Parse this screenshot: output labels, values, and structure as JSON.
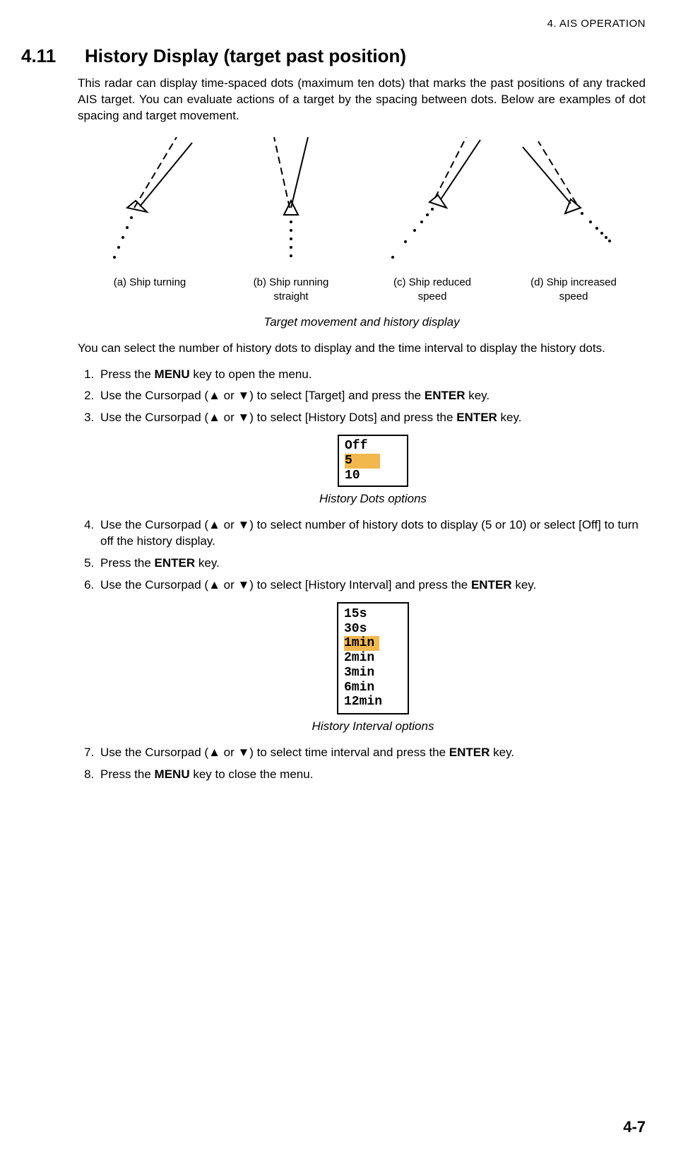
{
  "header": {
    "running": "4.  AIS OPERATION"
  },
  "section": {
    "number": "4.11",
    "title": "History Display (target past position)"
  },
  "intro": "This radar can display time-spaced dots (maximum ten dots) that marks the past positions of any tracked AIS target. You can evaluate actions of a target by the spacing between dots. Below are examples of dot spacing and target movement.",
  "fig_labels": {
    "a": "(a) Ship turning",
    "b_line1": "(b) Ship running",
    "b_line2": "straight",
    "c_line1": "(c) Ship reduced",
    "c_line2": "speed",
    "d_line1": "(d) Ship increased",
    "d_line2": "speed"
  },
  "fig_title": "Target movement and history display",
  "intro2": "You can select the number of history dots to display and the time interval to display the history dots.",
  "steps": {
    "s1_a": "Press the ",
    "s1_menu": "MENU",
    "s1_b": " key to open the menu.",
    "s2_a": "Use the Cursorpad (▲ or ▼) to select [Target] and press the ",
    "s2_enter": "ENTER",
    "s2_b": " key.",
    "s3_a": "Use the Cursorpad (▲ or ▼) to select [History Dots] and press the ",
    "s3_enter": "ENTER",
    "s3_b": " key.",
    "s4": "Use the Cursorpad (▲ or ▼) to select number of history dots to display (5 or 10) or select [Off] to turn off the history display.",
    "s5_a": "Press the ",
    "s5_enter": "ENTER",
    "s5_b": " key.",
    "s6_a": "Use the Cursorpad (▲ or ▼) to select [History Interval] and press the ",
    "s6_enter": "ENTER",
    "s6_b": " key.",
    "s7_a": "Use the Cursorpad (▲ or ▼) to select time interval and press the ",
    "s7_enter": "ENTER",
    "s7_b": " key.",
    "s8_a": "Press the ",
    "s8_menu": "MENU",
    "s8_b": " key to close the menu."
  },
  "dots_menu": {
    "caption": "History Dots options",
    "off": "Off",
    "five": "5",
    "ten": "10"
  },
  "interval_menu": {
    "caption": "History Interval options",
    "i15s": "15s",
    "i30s": "30s",
    "i1min": "1min",
    "i2min": "2min",
    "i3min": "3min",
    "i6min": "6min",
    "i12min": "12min"
  },
  "page_number": "4-7"
}
